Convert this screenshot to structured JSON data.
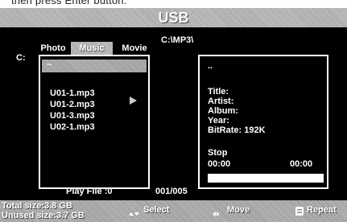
{
  "caption": "then press Enter button.",
  "window": {
    "title": "USB"
  },
  "tabs": [
    {
      "label": "Photo",
      "active": false
    },
    {
      "label": "Music",
      "active": true
    },
    {
      "label": "Movie",
      "active": false
    }
  ],
  "drive_label": "C:",
  "path": "C:\\MP3\\",
  "file_list": {
    "selected": "..",
    "items": [
      "U01-1.mp3",
      "U01-2.mp3",
      "U01-3.mp3",
      "U02-1.mp3"
    ]
  },
  "info_panel": {
    "name": "..",
    "title_label": "Title:",
    "artist_label": "Artist:",
    "album_label": "Album:",
    "year_label": "Year:",
    "bitrate_label": "BitRate: 192K",
    "status": "Stop",
    "elapsed": "00:00",
    "total": "00:00",
    "progress": 0
  },
  "play_file": "Play File  :0",
  "counter": "001/005",
  "footer": {
    "total_size": "Total size:3.8  GB",
    "unused_size": "Unused size:3.7  GB",
    "select_label": "Select",
    "move_label": "Move",
    "repeat_label": "Repeat"
  },
  "icons": {
    "select": "up-down-arrows-icon",
    "move": "left-right-arrows-icon",
    "repeat": "repeat-icon"
  },
  "colors": {
    "background": "#000000",
    "text": "#ffffff",
    "bar": "#b5b5b5"
  }
}
